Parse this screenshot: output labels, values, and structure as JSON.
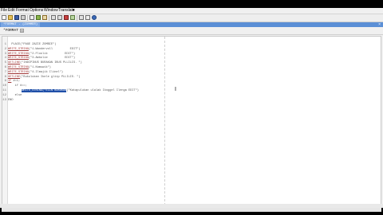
{
  "menubar": {
    "items": [
      "File",
      "Edit",
      "Format",
      "Options",
      "Window",
      "Translate"
    ],
    "overflow": "▾"
  },
  "toolbar": {
    "buttons": [
      "new-icon",
      "open-icon",
      "save-icon",
      "print-icon",
      "cut-icon",
      "copy-icon",
      "paste-icon",
      "undo-icon",
      "redo-icon",
      "find-icon",
      "replace-icon",
      "translate-icon",
      "settings-icon",
      "help-icon"
    ]
  },
  "tab": {
    "label": "*FORMAT - (ZUMMER)",
    "close": "×"
  },
  "document": {
    "name": "*FORMAT",
    "close": "×"
  },
  "editor": {
    "line_numbers": [
      "1",
      "2",
      "3",
      "4",
      "5",
      "6",
      "7",
      "8",
      "9",
      "10",
      "11",
      "12",
      "13"
    ],
    "lines": [
      {
        "pre": "  ",
        "kw": "",
        "post": "PLACE(\"PAGE ZAZIE ZOMBIE\")"
      },
      {
        "pre": "",
        "kw": "WRITE_STRING",
        "post": "(\"1.Wandervoll          EDIT\")"
      },
      {
        "pre": "",
        "kw": "WRITE_STRING",
        "post": "(\"2.Floolik          EDIT\")"
      },
      {
        "pre": "",
        "kw": "WRITE_STRING",
        "post": "(\"3.Ambolie          EDIT\")"
      },
      {
        "pre": "",
        "kw": "GETLINE",
        "post": "(\"INDIPINUS BURAKAN IBUS PLLILIS. \")"
      },
      {
        "pre": "",
        "kw": "WRITE_STRING",
        "post": "(\"1.Kamuwik\")"
      },
      {
        "pre": "",
        "kw": "WRITE_STRING",
        "post": "(\"4.Ilmajik Ilinel\")"
      },
      {
        "pre": "",
        "kw": "GETLINE",
        "post": "(\"Bukulukan Ikele gliip PLLILIS. \")"
      },
      {
        "pre": "",
        "kw": "IF",
        "post": " #=1;"
      },
      {
        "pre": "    if #==;",
        "kw": "",
        "post": ""
      },
      {
        "pre": "        ",
        "kw": "",
        "post": "(\"Katapulukan ulalak Ikoggel Ilenga EDIT\")",
        "selected": "WRITE_STRING(\"ELIN BURAKAN"
      },
      {
        "pre": "    else",
        "kw": "",
        "post": ""
      },
      {
        "pre": "END",
        "kw": "",
        "post": ""
      }
    ]
  },
  "cursor": "I"
}
